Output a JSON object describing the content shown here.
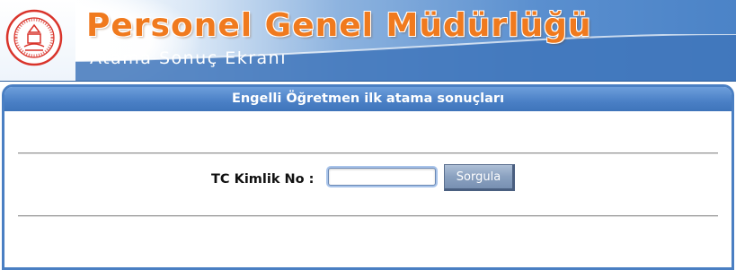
{
  "header": {
    "title": "Personel Genel Müdürlüğü",
    "subtitle": "Atama Sonuç Ekranı",
    "logo_icon": "meb-emblem-icon",
    "title_color": "#f07a1e",
    "banner_color": "#4d84c6"
  },
  "panel": {
    "title": "Engelli Öğretmen ilk atama sonuçları",
    "header_color": "#4a80c6"
  },
  "form": {
    "label": "TC Kimlik No :",
    "input_value": "",
    "input_placeholder": "",
    "button_label": "Sorgula"
  }
}
